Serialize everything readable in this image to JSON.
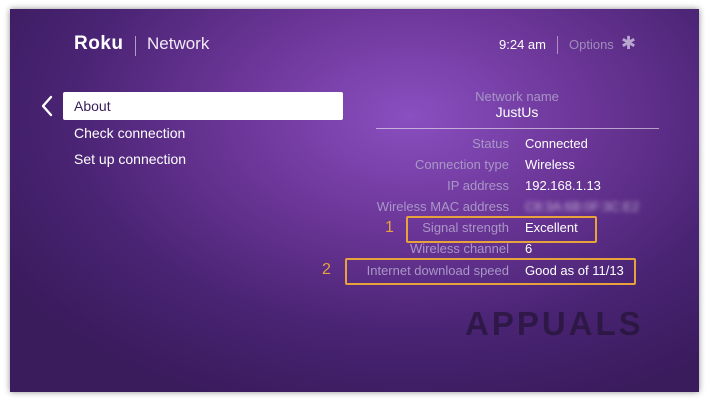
{
  "header": {
    "logo": "Roku",
    "title": "Network",
    "time": "9:24 am",
    "options_label": "Options",
    "options_icon": "asterisk-icon"
  },
  "menu": {
    "items": [
      {
        "label": "About",
        "selected": true
      },
      {
        "label": "Check connection",
        "selected": false
      },
      {
        "label": "Set up connection",
        "selected": false
      }
    ]
  },
  "details": {
    "network_name_label": "Network name",
    "network_name": "JustUs",
    "rows": [
      {
        "label": "Status",
        "value": "Connected"
      },
      {
        "label": "Connection type",
        "value": "Wireless"
      },
      {
        "label": "IP address",
        "value": "192.168.1.13"
      },
      {
        "label": "Wireless MAC address",
        "value": "C8:3A:6B:0F:3C:E2"
      },
      {
        "label": "Signal strength",
        "value": "Excellent"
      },
      {
        "label": "Wireless channel",
        "value": "6"
      },
      {
        "label": "Internet download speed",
        "value": "Good as of 11/13"
      }
    ]
  },
  "annotations": {
    "marker_1": "1",
    "marker_2": "2",
    "color": "#e8a23c"
  },
  "watermark": "APPUALS"
}
